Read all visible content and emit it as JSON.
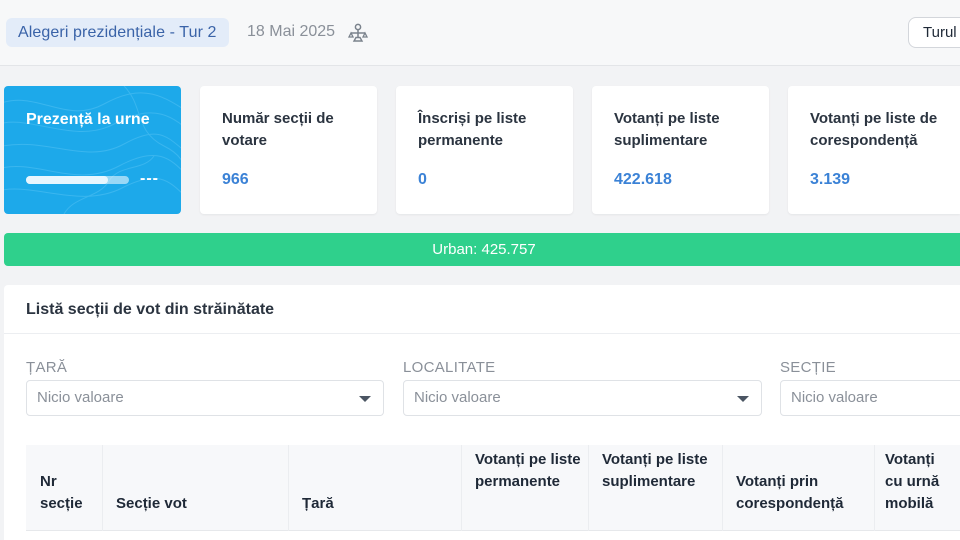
{
  "header": {
    "election_label": "Alegeri prezidențiale - Tur 2",
    "election_date": "18 Mai 2025",
    "history_icon": "history-balance-icon",
    "round_button_label": "Turul"
  },
  "stats": {
    "presence": {
      "label": "Prezență la urne",
      "value": "---",
      "progress": 0.8
    },
    "cards": [
      {
        "label": "Număr secții de votare",
        "value": "966"
      },
      {
        "label": "Înscriși pe liste permanente",
        "value": "0"
      },
      {
        "label": "Votanți pe liste suplimentare",
        "value": "422.618"
      },
      {
        "label": "Votanți pe liste de corespondență",
        "value": "3.139"
      }
    ]
  },
  "urban_bar": {
    "text": "Urban: 425.757"
  },
  "panel": {
    "title": "Listă secții de vot din străinătate",
    "filters": [
      {
        "label": "ȚARĂ",
        "placeholder": "Nicio valoare"
      },
      {
        "label": "LOCALITATE",
        "placeholder": "Nicio valoare"
      },
      {
        "label": "SECȚIE",
        "placeholder": "Nicio valoare"
      }
    ],
    "table_headers": [
      "Nr secție",
      "Secție vot",
      "Țară",
      "Votanți pe liste permanente",
      "Votanți pe liste suplimentare",
      "Votanți prin corespondență",
      "Votanți cu urnă mobilă"
    ]
  },
  "colors": {
    "accent_blue": "#3b82d6",
    "presence_card": "#1da9ea",
    "urban_green": "#2fd08c",
    "chip_bg": "#e3ecf9"
  }
}
